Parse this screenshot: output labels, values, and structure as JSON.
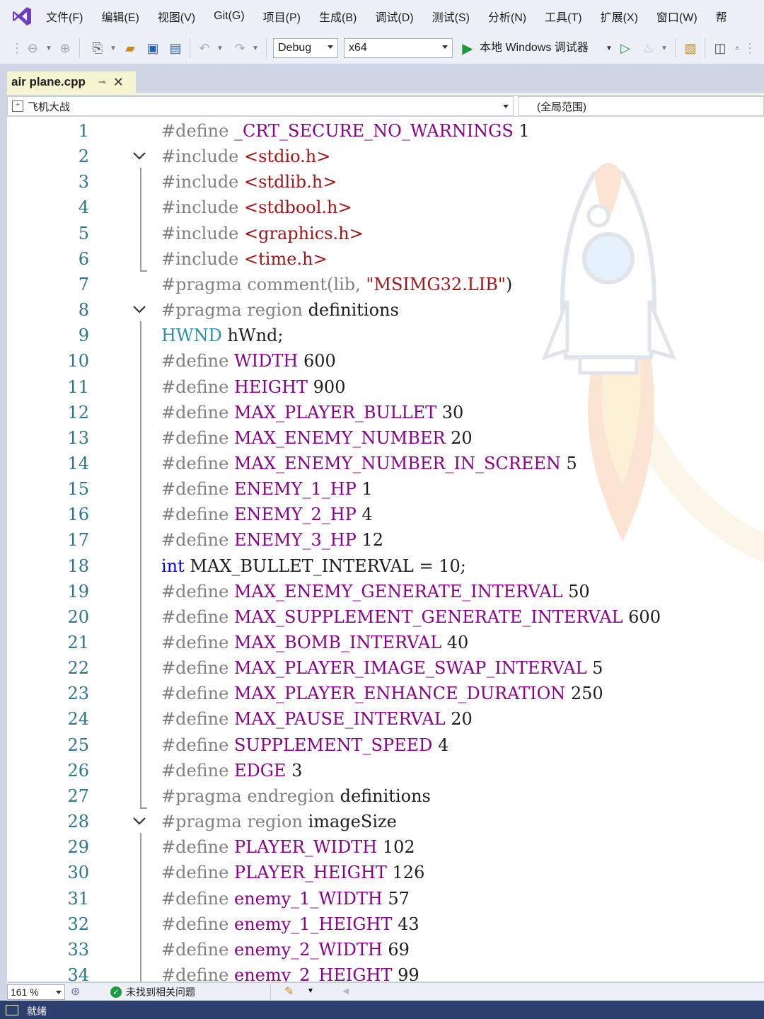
{
  "menu": [
    "文件(F)",
    "编辑(E)",
    "视图(V)",
    "Git(G)",
    "项目(P)",
    "生成(B)",
    "调试(D)",
    "测试(S)",
    "分析(N)",
    "工具(T)",
    "扩展(X)",
    "窗口(W)",
    "帮"
  ],
  "toolbar": {
    "config": "Debug",
    "platform": "x64",
    "run_target": "本地 Windows 调试器"
  },
  "tab": {
    "title": "air plane.cpp",
    "pin": "⊸",
    "close": "✕"
  },
  "navbar": {
    "scope": "飞机大战",
    "member": "(全局范围)"
  },
  "editor": {
    "lines": [
      {
        "n": "1",
        "t": [
          [
            "#define ",
            "pp"
          ],
          [
            "_CRT_SECURE_NO_WARNINGS",
            "mac"
          ],
          [
            " 1",
            "num"
          ]
        ]
      },
      {
        "n": "2",
        "t": [
          [
            "#include ",
            "pp"
          ],
          [
            "<stdio.h>",
            "str"
          ]
        ]
      },
      {
        "n": "3",
        "t": [
          [
            "#include ",
            "pp"
          ],
          [
            "<stdlib.h>",
            "str"
          ]
        ]
      },
      {
        "n": "4",
        "t": [
          [
            "#include ",
            "pp"
          ],
          [
            "<stdbool.h>",
            "str"
          ]
        ]
      },
      {
        "n": "5",
        "t": [
          [
            "#include ",
            "pp"
          ],
          [
            "<graphics.h>",
            "str"
          ]
        ]
      },
      {
        "n": "6",
        "t": [
          [
            "#include ",
            "pp"
          ],
          [
            "<time.h>",
            "str"
          ]
        ]
      },
      {
        "n": "7",
        "t": [
          [
            "#pragma comment(lib, ",
            "pp"
          ],
          [
            "\"MSIMG32.LIB\"",
            "str"
          ],
          [
            ")",
            "plain"
          ]
        ]
      },
      {
        "n": "8",
        "t": [
          [
            "#pragma region ",
            "pp"
          ],
          [
            "definitions",
            "plain"
          ]
        ]
      },
      {
        "n": "9",
        "t": [
          [
            "HWND",
            "typ"
          ],
          [
            " hWnd;",
            "plain"
          ]
        ]
      },
      {
        "n": "10",
        "t": [
          [
            "#define ",
            "pp"
          ],
          [
            "WIDTH",
            "mac"
          ],
          [
            " 600",
            "num"
          ]
        ]
      },
      {
        "n": "11",
        "t": [
          [
            "#define ",
            "pp"
          ],
          [
            "HEIGHT",
            "mac"
          ],
          [
            " 900",
            "num"
          ]
        ]
      },
      {
        "n": "12",
        "t": [
          [
            "#define ",
            "pp"
          ],
          [
            "MAX_PLAYER_BULLET",
            "mac"
          ],
          [
            " 30",
            "num"
          ]
        ]
      },
      {
        "n": "13",
        "t": [
          [
            "#define ",
            "pp"
          ],
          [
            "MAX_ENEMY_NUMBER",
            "mac"
          ],
          [
            " 20",
            "num"
          ]
        ]
      },
      {
        "n": "14",
        "t": [
          [
            "#define ",
            "pp"
          ],
          [
            "MAX_ENEMY_NUMBER_IN_SCREEN",
            "mac"
          ],
          [
            " 5",
            "num"
          ]
        ]
      },
      {
        "n": "15",
        "t": [
          [
            "#define ",
            "pp"
          ],
          [
            "ENEMY_1_HP",
            "mac"
          ],
          [
            " 1",
            "num"
          ]
        ]
      },
      {
        "n": "16",
        "t": [
          [
            "#define ",
            "pp"
          ],
          [
            "ENEMY_2_HP",
            "mac"
          ],
          [
            " 4",
            "num"
          ]
        ]
      },
      {
        "n": "17",
        "t": [
          [
            "#define ",
            "pp"
          ],
          [
            "ENEMY_3_HP",
            "mac"
          ],
          [
            " 12",
            "num"
          ]
        ]
      },
      {
        "n": "18",
        "t": [
          [
            "int",
            "kw"
          ],
          [
            " MAX_BULLET_INTERVAL = 10;",
            "plain"
          ]
        ]
      },
      {
        "n": "19",
        "t": [
          [
            "#define ",
            "pp"
          ],
          [
            "MAX_ENEMY_GENERATE_INTERVAL",
            "mac"
          ],
          [
            " 50",
            "num"
          ]
        ]
      },
      {
        "n": "20",
        "t": [
          [
            "#define ",
            "pp"
          ],
          [
            "MAX_SUPPLEMENT_GENERATE_INTERVAL",
            "mac"
          ],
          [
            " 600",
            "num"
          ]
        ]
      },
      {
        "n": "21",
        "t": [
          [
            "#define ",
            "pp"
          ],
          [
            "MAX_BOMB_INTERVAL",
            "mac"
          ],
          [
            " 40",
            "num"
          ]
        ]
      },
      {
        "n": "22",
        "t": [
          [
            "#define ",
            "pp"
          ],
          [
            "MAX_PLAYER_IMAGE_SWAP_INTERVAL",
            "mac"
          ],
          [
            " 5",
            "num"
          ]
        ]
      },
      {
        "n": "23",
        "t": [
          [
            "#define ",
            "pp"
          ],
          [
            "MAX_PLAYER_ENHANCE_DURATION",
            "mac"
          ],
          [
            " 250",
            "num"
          ]
        ]
      },
      {
        "n": "24",
        "t": [
          [
            "#define ",
            "pp"
          ],
          [
            "MAX_PAUSE_INTERVAL",
            "mac"
          ],
          [
            " 20",
            "num"
          ]
        ]
      },
      {
        "n": "25",
        "t": [
          [
            "#define ",
            "pp"
          ],
          [
            "SUPPLEMENT_SPEED",
            "mac"
          ],
          [
            " 4",
            "num"
          ]
        ]
      },
      {
        "n": "26",
        "t": [
          [
            "#define ",
            "pp"
          ],
          [
            "EDGE",
            "mac"
          ],
          [
            " 3",
            "num"
          ]
        ]
      },
      {
        "n": "27",
        "t": [
          [
            "#pragma endregion ",
            "pp"
          ],
          [
            "definitions",
            "plain"
          ]
        ]
      },
      {
        "n": "28",
        "t": [
          [
            "#pragma region ",
            "pp"
          ],
          [
            "imageSize",
            "plain"
          ]
        ]
      },
      {
        "n": "29",
        "t": [
          [
            "#define ",
            "pp"
          ],
          [
            "PLAYER_WIDTH",
            "mac"
          ],
          [
            " 102",
            "num"
          ]
        ]
      },
      {
        "n": "30",
        "t": [
          [
            "#define ",
            "pp"
          ],
          [
            "PLAYER_HEIGHT",
            "mac"
          ],
          [
            " 126",
            "num"
          ]
        ]
      },
      {
        "n": "31",
        "t": [
          [
            "#define ",
            "pp"
          ],
          [
            "enemy_1_WIDTH",
            "mac"
          ],
          [
            " 57",
            "num"
          ]
        ]
      },
      {
        "n": "32",
        "t": [
          [
            "#define ",
            "pp"
          ],
          [
            "enemy_1_HEIGHT",
            "mac"
          ],
          [
            " 43",
            "num"
          ]
        ]
      },
      {
        "n": "33",
        "t": [
          [
            "#define ",
            "pp"
          ],
          [
            "enemy_2_WIDTH",
            "mac"
          ],
          [
            " 69",
            "num"
          ]
        ]
      },
      {
        "n": "34",
        "t": [
          [
            "#define ",
            "pp"
          ],
          [
            "enemy_2_HEIGHT",
            "mac"
          ],
          [
            " 99",
            "num"
          ]
        ]
      }
    ]
  },
  "status": {
    "zoom": "161 %",
    "issues": "未找到相关问题",
    "issues_icon": "✓",
    "ready": "就绪"
  },
  "colors": {
    "preprocessor": "#808080",
    "macro": "#8b008b",
    "string": "#a31515",
    "keyword": "#0000ff",
    "type": "#2b91af",
    "line_number": "#2b7590",
    "accent": "#2d3f6e"
  }
}
